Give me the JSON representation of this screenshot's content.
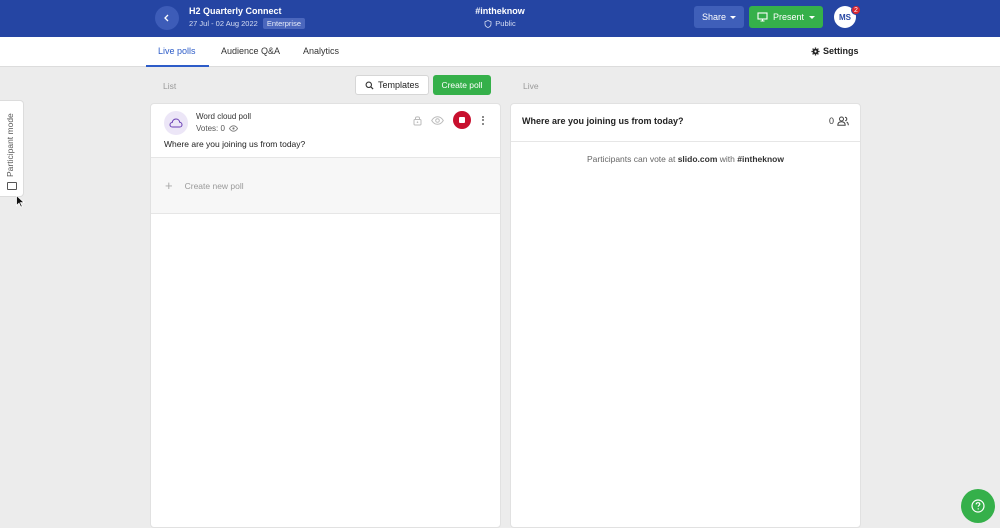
{
  "header": {
    "event_title": "H2 Quarterly Connect",
    "event_dates": "27 Jul - 02 Aug 2022",
    "plan_badge": "Enterprise",
    "event_code": "#intheknow",
    "privacy": "Public",
    "share_label": "Share",
    "present_label": "Present",
    "avatar_initials": "MS",
    "notification_count": "2",
    "colors": {
      "bar": "#2545a3",
      "present": "#35b04a"
    }
  },
  "tabs": {
    "items": [
      {
        "label": "Live polls",
        "active": true
      },
      {
        "label": "Audience Q&A",
        "active": false
      },
      {
        "label": "Analytics",
        "active": false
      }
    ],
    "settings_label": "Settings"
  },
  "list": {
    "section_label": "List",
    "templates_label": "Templates",
    "create_poll_label": "Create poll",
    "poll": {
      "type": "Word cloud poll",
      "votes": "Votes: 0",
      "question": "Where are you joining us from today?",
      "icon": "cloud-icon"
    },
    "create_new_label": "Create new poll"
  },
  "live": {
    "section_label": "Live",
    "question": "Where are you joining us from today?",
    "participant_count": "0",
    "hint_prefix": "Participants can vote at ",
    "hint_site": "slido.com",
    "hint_middle": " with ",
    "hint_code": "#intheknow"
  },
  "side_tab": {
    "label": "Participant mode"
  }
}
